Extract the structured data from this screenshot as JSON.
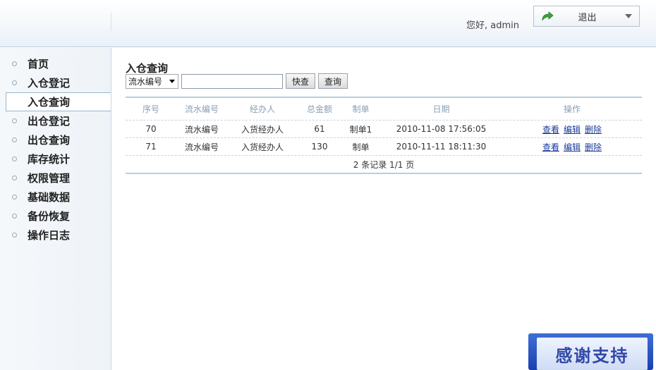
{
  "header": {
    "greeting": "您好, admin",
    "logout_label": "退出"
  },
  "sidebar": {
    "items": [
      {
        "label": "首页"
      },
      {
        "label": "入仓登记"
      },
      {
        "label": "入仓查询",
        "active": true
      },
      {
        "label": "出仓登记"
      },
      {
        "label": "出仓查询"
      },
      {
        "label": "库存统计"
      },
      {
        "label": "权限管理"
      },
      {
        "label": "基础数据"
      },
      {
        "label": "备份恢复"
      },
      {
        "label": "操作日志"
      }
    ]
  },
  "main": {
    "title": "入仓查询",
    "filter": {
      "select_value": "流水编号",
      "input_value": "",
      "quick_button": "快查",
      "query_button": "查询"
    },
    "table": {
      "headers": [
        "序号",
        "流水编号",
        "经办人",
        "总金额",
        "制单",
        "日期",
        "操作"
      ],
      "rows": [
        {
          "id": "70",
          "serial": "流水编号",
          "handler": "入货经办人",
          "amount": "61",
          "maker": "制单1",
          "date": "2010-11-08 17:56:05"
        },
        {
          "id": "71",
          "serial": "流水编号",
          "handler": "入货经办人",
          "amount": "130",
          "maker": "制单",
          "date": "2010-11-11 18:11:30"
        }
      ],
      "actions": [
        "查看",
        "编辑",
        "删除"
      ],
      "summary": "2 条记录  1/1 页"
    }
  },
  "banner": {
    "text": "感谢支持"
  },
  "colors": {
    "accent_border": "#b6cfdf",
    "link": "#1a3a9a",
    "banner_blue": "#1a3fb0"
  }
}
